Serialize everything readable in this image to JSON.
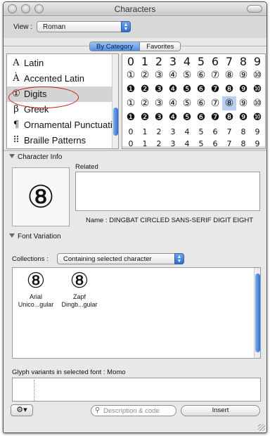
{
  "window": {
    "title": "Characters"
  },
  "toolbar": {
    "view_label": "View :",
    "view_value": "Roman"
  },
  "tabs": [
    {
      "label": "By Category",
      "active": true
    },
    {
      "label": "Favorites",
      "active": false
    }
  ],
  "categories": [
    {
      "icon": "A",
      "label": "Latin"
    },
    {
      "icon": "À",
      "label": "Accented Latin"
    },
    {
      "icon": "①",
      "label": "Digits",
      "selected": true
    },
    {
      "icon": "β",
      "label": "Greek"
    },
    {
      "icon": "¶",
      "label": "Ornamental Punctuation"
    },
    {
      "icon": "⠿",
      "label": "Braille Patterns"
    }
  ],
  "character_grid": [
    [
      "0",
      "1",
      "2",
      "3",
      "4",
      "5",
      "6",
      "7",
      "8",
      "9"
    ],
    [
      "①",
      "②",
      "③",
      "④",
      "⑤",
      "⑥",
      "⑦",
      "⑧",
      "⑨",
      "⑩"
    ],
    [
      "❶",
      "❷",
      "❸",
      "❹",
      "❺",
      "❻",
      "❼",
      "❽",
      "❾",
      "❿"
    ],
    [
      "①",
      "②",
      "③",
      "④",
      "⑤",
      "⑥",
      "⑦",
      "⑧",
      "⑨",
      "⑩"
    ],
    [
      "❶",
      "❷",
      "❸",
      "❹",
      "❺",
      "❻",
      "❼",
      "❽",
      "❾",
      "❿"
    ],
    [
      "0",
      "1",
      "2",
      "3",
      "4",
      "5",
      "6",
      "7",
      "8",
      "9"
    ],
    [
      "0",
      "1",
      "2",
      "3",
      "4",
      "5",
      "6",
      "7",
      "8",
      "9"
    ]
  ],
  "selected_cell": {
    "row": 3,
    "col": 7
  },
  "character_info": {
    "section_label": "Character Info",
    "preview_glyph": "⑧",
    "related_label": "Related",
    "name_line": "Name : DINGBAT CIRCLED SANS-SERIF DIGIT EIGHT"
  },
  "font_variation": {
    "section_label": "Font Variation",
    "collections_label": "Collections :",
    "collections_value": "Containing selected character",
    "fonts": [
      {
        "glyph": "⑧",
        "name": "Arial",
        "style": "Unico...gular"
      },
      {
        "glyph": "⑧",
        "name": "Zapf",
        "style": "Dingb...gular"
      }
    ],
    "glyph_variants_label": "Glyph variants in selected font : Momo"
  },
  "bottom": {
    "gear_label": "⚙▾",
    "search_placeholder": "Description & code",
    "insert_label": "Insert"
  },
  "colors": {
    "accent": "#3b7be0",
    "highlight_ring": "#d01818",
    "selection": "#b7cff0"
  }
}
